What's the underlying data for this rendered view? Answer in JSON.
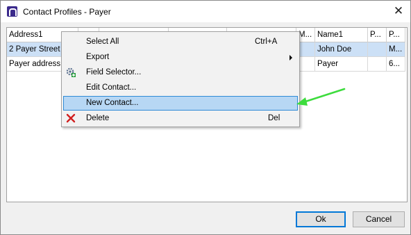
{
  "window": {
    "title": "Contact Profiles - Payer",
    "close_glyph": "✕"
  },
  "grid": {
    "columns": [
      "Address1",
      "",
      "",
      "",
      "",
      "M...",
      "Name1",
      "P...",
      "P..."
    ],
    "rows": [
      {
        "address1": "2 Payer Street",
        "name1": "John Doe",
        "p2": "M...",
        "selected": true
      },
      {
        "address1": "Payer address",
        "name1": "Payer",
        "p2": "6...",
        "selected": false
      }
    ]
  },
  "context_menu": {
    "items": [
      {
        "label": "Select All",
        "shortcut": "Ctrl+A"
      },
      {
        "label": "Export",
        "submenu": true
      },
      {
        "label": "Field Selector...",
        "icon": "field-selector-icon"
      },
      {
        "label": "Edit Contact..."
      },
      {
        "label": "New Contact...",
        "highlighted": true
      },
      {
        "label": "Delete",
        "shortcut": "Del",
        "icon": "delete-x-icon"
      }
    ]
  },
  "buttons": {
    "ok": "Ok",
    "cancel": "Cancel"
  },
  "colors": {
    "selection": "#cce0f6",
    "menu_highlight": "#b7d7f4",
    "accent": "#0078d7",
    "annotation_arrow": "#3ddc3d",
    "delete_icon": "#d11f1f"
  }
}
